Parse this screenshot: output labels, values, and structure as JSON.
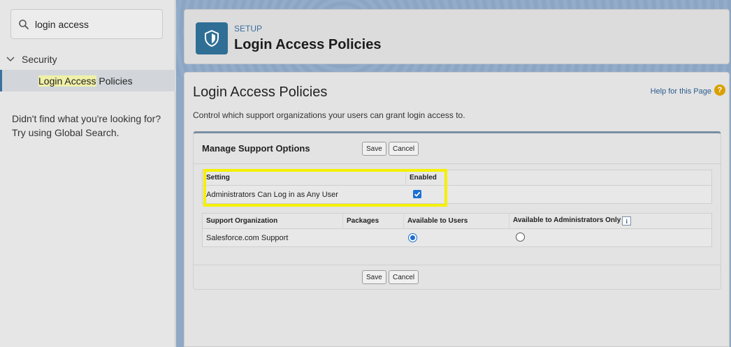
{
  "sidebar": {
    "search": {
      "value": "login access",
      "placeholder": "Quick Find"
    },
    "tree": {
      "parent_label": "Security",
      "child_match": "Login Access",
      "child_rest": " Policies"
    },
    "not_found_line1": "Didn't find what you're looking for?",
    "not_found_line2": "Try using Global Search."
  },
  "header": {
    "eyebrow": "SETUP",
    "title": "Login Access Policies"
  },
  "content": {
    "title": "Login Access Policies",
    "help_link": "Help for this Page",
    "help_icon_glyph": "?",
    "description": "Control which support organizations your users can grant login access to."
  },
  "manage": {
    "title": "Manage Support Options",
    "save_label": "Save",
    "cancel_label": "Cancel",
    "settings_table": {
      "headers": [
        "Setting",
        "Enabled"
      ],
      "rows": [
        {
          "setting": "Administrators Can Log in as Any User",
          "enabled": true
        }
      ]
    },
    "orgs_table": {
      "headers": [
        "Support Organization",
        "Packages",
        "Available to Users",
        "Available to Administrators Only"
      ],
      "info_glyph": "i",
      "rows": [
        {
          "org": "Salesforce.com Support",
          "packages": "",
          "available_to_users": true,
          "available_to_admins_only": false
        }
      ]
    }
  },
  "colors": {
    "accent": "#1a6fd4",
    "header_icon_bg": "#2f6f96",
    "highlight_box": "#f5f000",
    "search_match": "#f0f0a8"
  }
}
